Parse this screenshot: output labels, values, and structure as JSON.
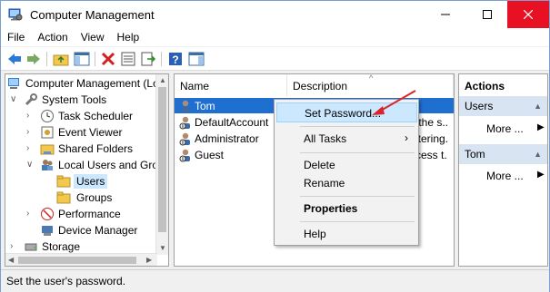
{
  "window": {
    "title": "Computer Management"
  },
  "menu": [
    "File",
    "Action",
    "View",
    "Help"
  ],
  "tree": {
    "root": "Computer Management (Lo",
    "system_tools": "System Tools",
    "task_scheduler": "Task Scheduler",
    "event_viewer": "Event Viewer",
    "shared_folders": "Shared Folders",
    "local_users": "Local Users and Grou",
    "users": "Users",
    "groups": "Groups",
    "performance": "Performance",
    "device_manager": "Device Manager",
    "storage": "Storage"
  },
  "list": {
    "headers": {
      "name": "Name",
      "description": "Description"
    },
    "rows": [
      {
        "name": "Tom",
        "description": ""
      },
      {
        "name": "DefaultAccount",
        "description": "v the s.."
      },
      {
        "name": "Administrator",
        "description": "istering."
      },
      {
        "name": "Guest",
        "description": "ccess t."
      }
    ]
  },
  "context_menu": {
    "set_password": "Set Password...",
    "all_tasks": "All Tasks",
    "delete": "Delete",
    "rename": "Rename",
    "properties": "Properties",
    "help": "Help"
  },
  "actions": {
    "title": "Actions",
    "section1": "Users",
    "more1": "More ...",
    "section2": "Tom",
    "more2": "More ..."
  },
  "status": {
    "text": "Set the user's password."
  },
  "colors": {
    "selection": "#1f6fd1",
    "close": "#e81123",
    "arrow": "#d9252a"
  }
}
